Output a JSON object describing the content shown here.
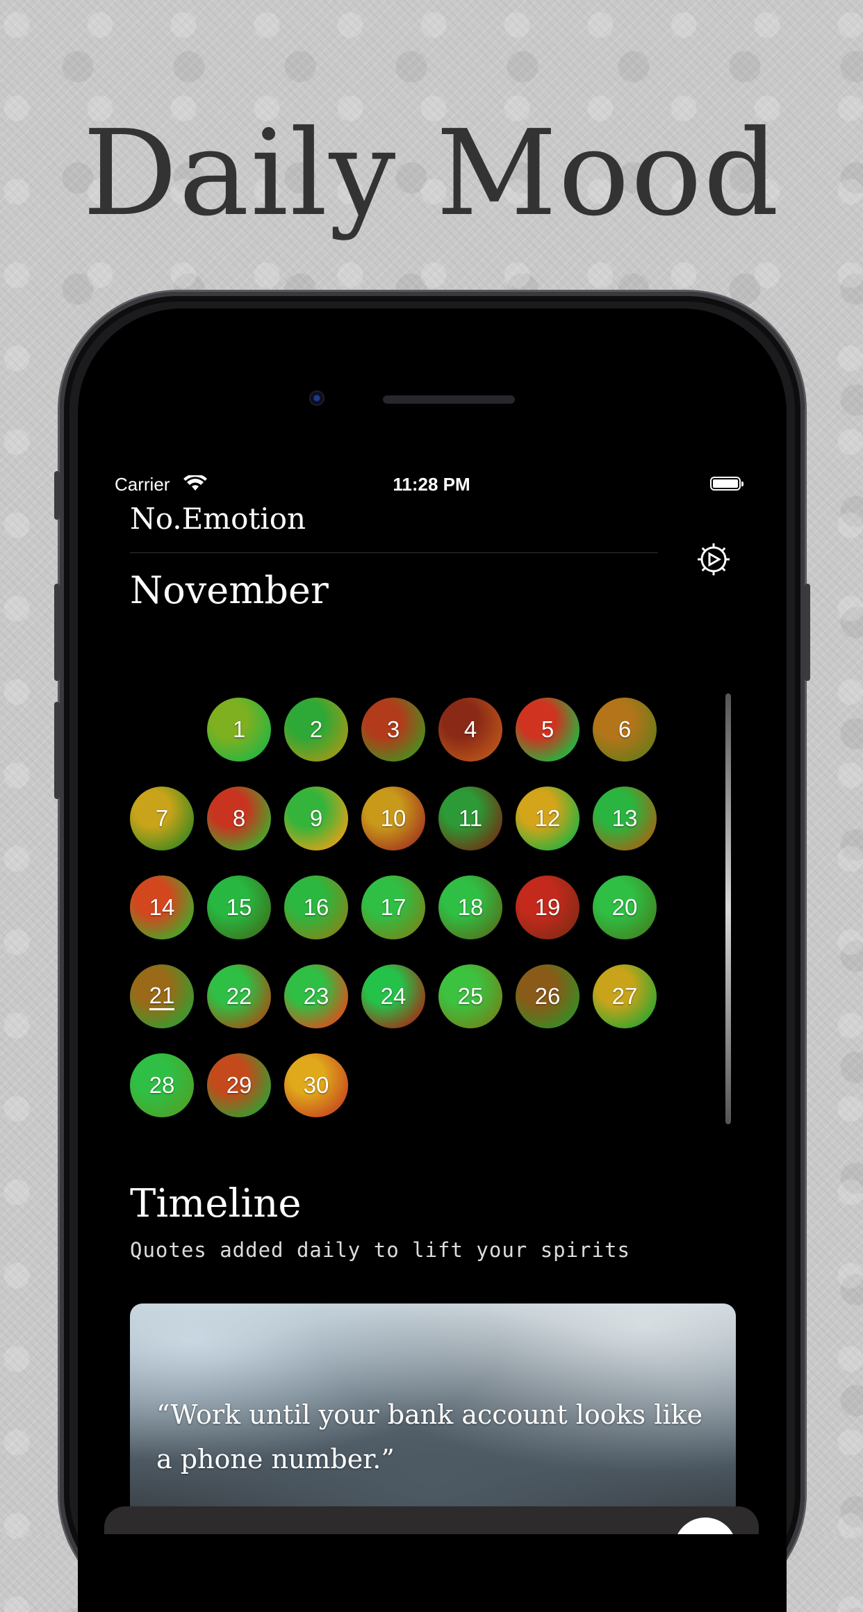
{
  "headline": "Daily Mood",
  "status_bar": {
    "carrier": "Carrier",
    "time": "11:28 PM"
  },
  "app": {
    "title": "No.Emotion"
  },
  "calendar": {
    "month": "November",
    "first_weekday_offset": 1,
    "today": 21,
    "days": [
      {
        "label": "1",
        "colors": [
          "#7fb020",
          "#2bb541"
        ]
      },
      {
        "label": "2",
        "colors": [
          "#2ea836",
          "#9a9a1a"
        ]
      },
      {
        "label": "3",
        "colors": [
          "#b23b1c",
          "#4d8c1e"
        ]
      },
      {
        "label": "4",
        "colors": [
          "#8a2a16",
          "#b7521a"
        ]
      },
      {
        "label": "5",
        "colors": [
          "#d03320",
          "#25b540"
        ]
      },
      {
        "label": "6",
        "colors": [
          "#b4751a",
          "#6f7a1a"
        ]
      },
      {
        "label": "7",
        "colors": [
          "#c9a41a",
          "#4a8a1e"
        ]
      },
      {
        "label": "8",
        "colors": [
          "#c83420",
          "#4aa52a"
        ]
      },
      {
        "label": "9",
        "colors": [
          "#34b43a",
          "#d9a21b"
        ]
      },
      {
        "label": "10",
        "colors": [
          "#c99a1a",
          "#a5401e"
        ]
      },
      {
        "label": "11",
        "colors": [
          "#2c9a36",
          "#6b3a16"
        ]
      },
      {
        "label": "12",
        "colors": [
          "#d4a41a",
          "#30b03c"
        ]
      },
      {
        "label": "13",
        "colors": [
          "#2ab540",
          "#9a6a18"
        ]
      },
      {
        "label": "14",
        "colors": [
          "#d3471e",
          "#4aa52a"
        ]
      },
      {
        "label": "15",
        "colors": [
          "#28b842",
          "#3a7a20"
        ]
      },
      {
        "label": "16",
        "colors": [
          "#2cb740",
          "#7a8a1c"
        ]
      },
      {
        "label": "17",
        "colors": [
          "#2fbf45",
          "#6f8c1e"
        ]
      },
      {
        "label": "18",
        "colors": [
          "#2fbf45",
          "#4f7a20"
        ]
      },
      {
        "label": "19",
        "colors": [
          "#c42a1c",
          "#8a2a16"
        ]
      },
      {
        "label": "20",
        "colors": [
          "#2fbf45",
          "#3f8a24"
        ]
      },
      {
        "label": "21",
        "colors": [
          "#9a6a18",
          "#3a9a30"
        ]
      },
      {
        "label": "22",
        "colors": [
          "#2fbf45",
          "#9a5a18"
        ]
      },
      {
        "label": "23",
        "colors": [
          "#2fbf45",
          "#d3541e"
        ]
      },
      {
        "label": "24",
        "colors": [
          "#25c24a",
          "#9a3a18"
        ]
      },
      {
        "label": "25",
        "colors": [
          "#3cc23f",
          "#6a8a1e"
        ]
      },
      {
        "label": "26",
        "colors": [
          "#8a5a18",
          "#3a8a24"
        ]
      },
      {
        "label": "27",
        "colors": [
          "#c9a41a",
          "#3aa52e"
        ]
      },
      {
        "label": "28",
        "colors": [
          "#2fbf45",
          "#4aa52a"
        ]
      },
      {
        "label": "29",
        "colors": [
          "#c44a1c",
          "#3a9a30"
        ]
      },
      {
        "label": "30",
        "colors": [
          "#e0a81b",
          "#c8501e"
        ]
      }
    ]
  },
  "timeline": {
    "title": "Timeline",
    "subtitle": "Quotes added daily to lift your spirits",
    "quote": "“Work until your bank account looks like a phone number.”"
  }
}
